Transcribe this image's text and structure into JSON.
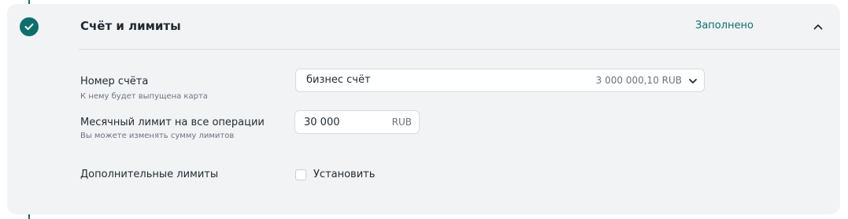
{
  "section": {
    "title": "Счёт и лимиты",
    "status": "Заполнено"
  },
  "account": {
    "label": "Номер счёта",
    "hint": "К нему будет выпущена карта",
    "selected": "бизнес счёт",
    "balance": "3 000 000,10 RUB"
  },
  "monthly_limit": {
    "label": "Месячный лимит на все операции",
    "hint": "Вы можете изменять сумму лимитов",
    "value": "30 000",
    "currency": "RUB"
  },
  "extra_limits": {
    "label": "Дополнительные лимиты",
    "checkbox_label": "Установить",
    "checked": false
  },
  "colors": {
    "accent": "#0e6e6e",
    "card_background": "#f2f3f5"
  },
  "icons": {
    "step": "check-icon",
    "collapse": "chevron-up-icon",
    "select": "chevron-down-icon"
  }
}
